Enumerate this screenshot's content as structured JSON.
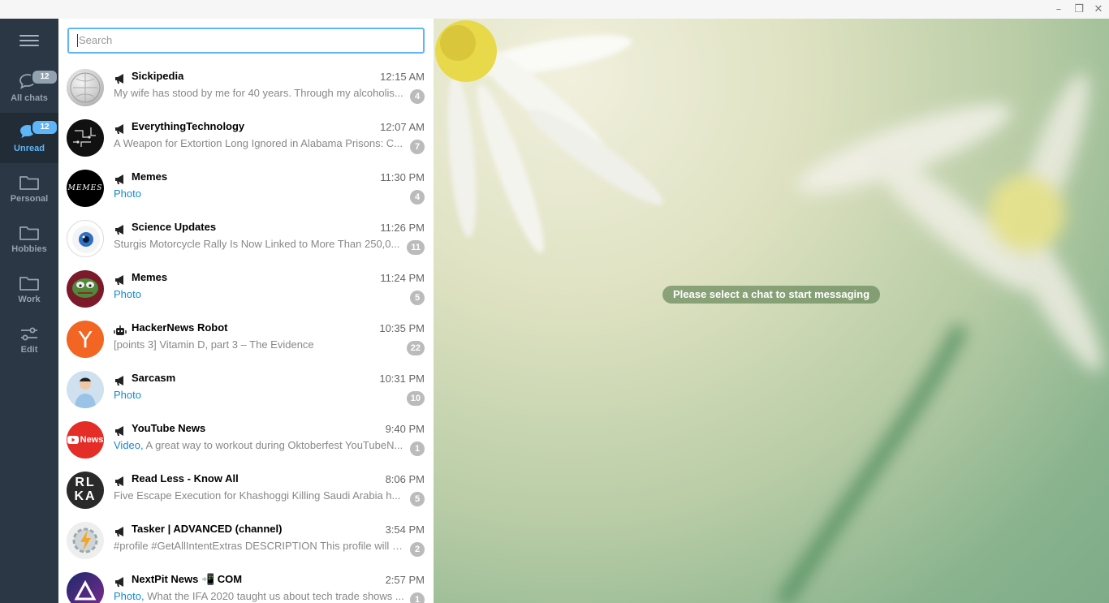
{
  "window": {
    "minimize": "–",
    "restore": "❐",
    "close": "✕"
  },
  "folders": [
    {
      "label": "All chats",
      "icon": "chat-bubbles-icon",
      "badge": "12",
      "active": false
    },
    {
      "label": "Unread",
      "icon": "chat-bubbles-icon",
      "badge": "12",
      "active": true
    },
    {
      "label": "Personal",
      "icon": "folder-icon",
      "badge": null,
      "active": false
    },
    {
      "label": "Hobbies",
      "icon": "folder-icon",
      "badge": null,
      "active": false
    },
    {
      "label": "Work",
      "icon": "folder-icon",
      "badge": null,
      "active": false
    },
    {
      "label": "Edit",
      "icon": "sliders-icon",
      "badge": null,
      "active": false
    }
  ],
  "search": {
    "placeholder": "Search"
  },
  "chats": [
    {
      "name": "Sickipedia",
      "time": "12:15 AM",
      "media": "",
      "preview": "My wife has stood by me for 40 years. Through my alcoholis...",
      "unread": "4",
      "kind": "channel"
    },
    {
      "name": "EverythingTechnology",
      "time": "12:07 AM",
      "media": "",
      "preview": "A Weapon for Extortion Long Ignored in Alabama Prisons: C...",
      "unread": "7",
      "kind": "channel"
    },
    {
      "name": "Memes",
      "time": "11:30 PM",
      "media": "Photo",
      "preview": "",
      "unread": "4",
      "kind": "channel"
    },
    {
      "name": "Science Updates",
      "time": "11:26 PM",
      "media": "",
      "preview": "Sturgis Motorcycle Rally Is Now Linked to More Than 250,0...",
      "unread": "11",
      "kind": "channel"
    },
    {
      "name": "Memes",
      "time": "11:24 PM",
      "media": "Photo",
      "preview": "",
      "unread": "5",
      "kind": "channel"
    },
    {
      "name": "HackerNews Robot",
      "time": "10:35 PM",
      "media": "",
      "preview": "[points 3]  Vitamin D, part 3 – The Evidence",
      "unread": "22",
      "kind": "bot"
    },
    {
      "name": "Sarcasm",
      "time": "10:31 PM",
      "media": "Photo",
      "preview": "",
      "unread": "10",
      "kind": "channel"
    },
    {
      "name": "YouTube News",
      "time": "9:40 PM",
      "media": "Video,",
      "preview": " A great way to workout during Oktoberfest  YouTubeN...",
      "unread": "1",
      "kind": "channel"
    },
    {
      "name": "Read Less - Know All",
      "time": "8:06 PM",
      "media": "",
      "preview": "Five Escape Execution for Khashoggi Killing  Saudi Arabia h...",
      "unread": "5",
      "kind": "channel"
    },
    {
      "name": "Tasker | ADVANCED (channel)",
      "time": "3:54 PM",
      "media": "",
      "preview": "#profile #GetAllIntentExtras DESCRIPTION This profile will a...",
      "unread": "2",
      "kind": "channel"
    },
    {
      "name": "NextPit News 📲 COM",
      "time": "2:57 PM",
      "media": "Photo,",
      "preview": " What the IFA 2020 taught us about tech trade shows ...",
      "unread": "1",
      "kind": "channel"
    }
  ],
  "avatar_texts": {
    "memes1": "MEMES",
    "hn": "Y",
    "yt": "News",
    "rlka_top": "RL",
    "rlka_bottom": "KA"
  },
  "main": {
    "placeholder": "Please select a chat to start messaging"
  },
  "colors": {
    "sidebar": "#2b3744",
    "accent": "#5eb5f7",
    "link": "#168acd",
    "badge": "#bbbbbb"
  }
}
